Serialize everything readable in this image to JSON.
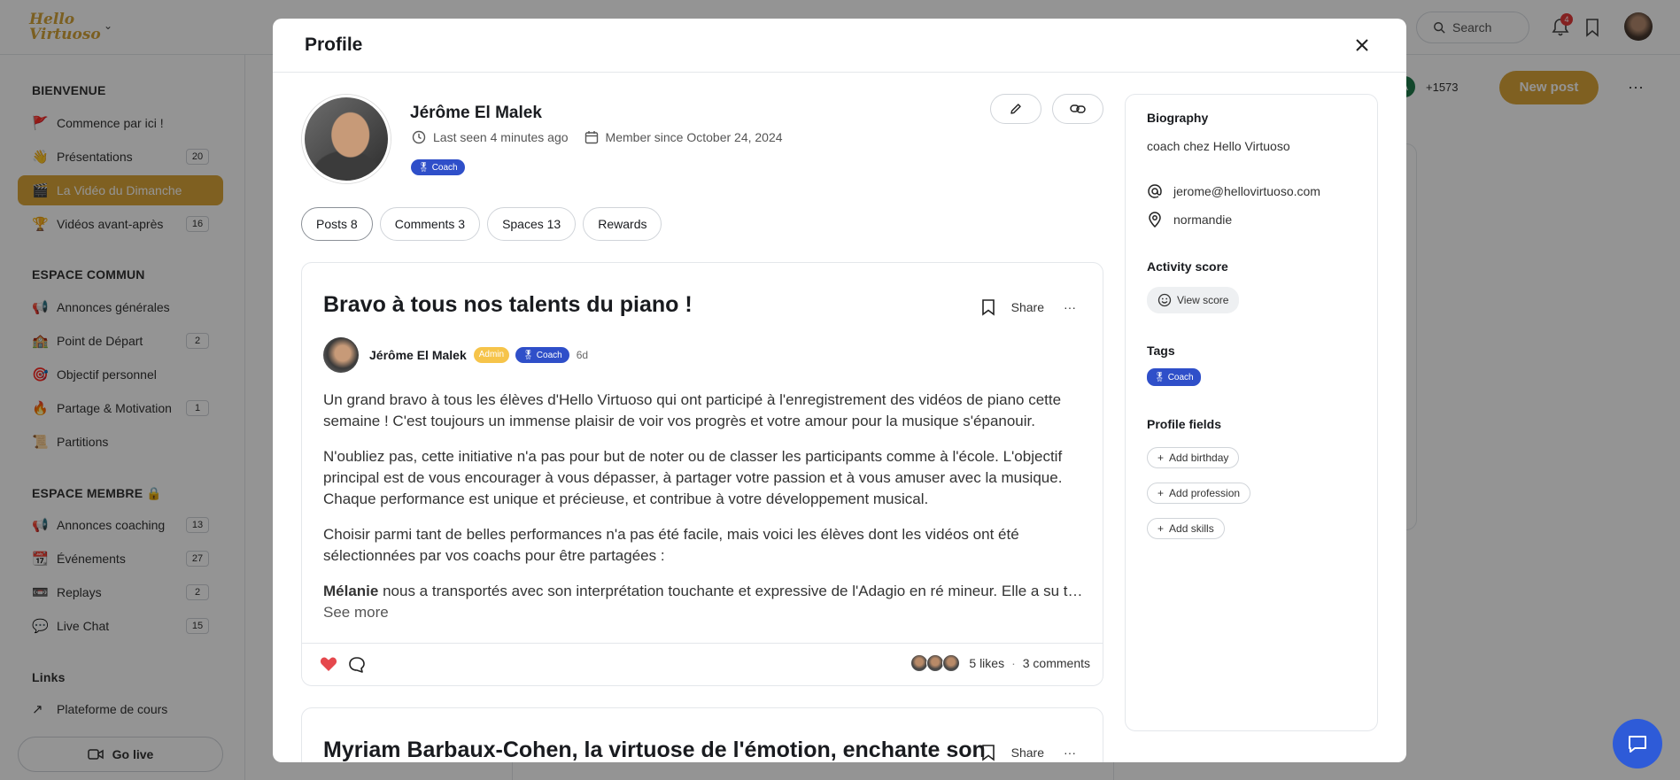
{
  "header": {
    "logo_line1": "Hello",
    "logo_line2": "Virtuoso",
    "search_label": "Search",
    "notification_count": "4"
  },
  "sidebar": {
    "sections": [
      {
        "title": "BIENVENUE",
        "items": [
          {
            "emoji": "🚩",
            "label": "Commence par ici !",
            "count": ""
          },
          {
            "emoji": "👋",
            "label": "Présentations",
            "count": "20"
          },
          {
            "emoji": "🎬",
            "label": "La Vidéo du Dimanche",
            "count": "",
            "active": true
          },
          {
            "emoji": "🏆",
            "label": "Vidéos avant-après",
            "count": "16"
          }
        ]
      },
      {
        "title": "ESPACE COMMUN",
        "items": [
          {
            "emoji": "📢",
            "label": "Annonces générales",
            "count": ""
          },
          {
            "emoji": "🏫",
            "label": "Point de Départ",
            "count": "2"
          },
          {
            "emoji": "🎯",
            "label": "Objectif personnel",
            "count": ""
          },
          {
            "emoji": "🔥",
            "label": "Partage & Motivation",
            "count": "1"
          },
          {
            "emoji": "📜",
            "label": "Partitions",
            "count": ""
          }
        ]
      },
      {
        "title": "ESPACE MEMBRE 🔒",
        "items": [
          {
            "emoji": "📢",
            "label": "Annonces coaching",
            "count": "13"
          },
          {
            "emoji": "📆",
            "label": "Événements",
            "count": "27"
          },
          {
            "emoji": "📼",
            "label": "Replays",
            "count": "2"
          },
          {
            "emoji": "💬",
            "label": "Live Chat",
            "count": "15"
          }
        ]
      },
      {
        "title": "Links",
        "items": [
          {
            "emoji": "↗",
            "label": "Plateforme de cours",
            "count": ""
          }
        ]
      }
    ],
    "go_live_label": "Go live"
  },
  "topbar": {
    "member_initial": "A",
    "member_count": "+1573",
    "new_post_label": "New post"
  },
  "modal": {
    "title": "Profile",
    "profile": {
      "name": "Jérôme El Malek",
      "last_seen": "Last seen 4 minutes ago",
      "member_since": "Member since October 24, 2024",
      "badge": "Coach"
    },
    "tabs": [
      {
        "label": "Posts 8",
        "active": true
      },
      {
        "label": "Comments 3"
      },
      {
        "label": "Spaces 13"
      },
      {
        "label": "Rewards"
      }
    ],
    "posts": [
      {
        "title": "Bravo à tous nos talents du piano !",
        "share_label": "Share",
        "author": "Jérôme El Malek",
        "admin_badge": "Admin",
        "coach_badge": "Coach",
        "age": "6d",
        "paragraphs": [
          "Un grand bravo à tous les élèves d'Hello Virtuoso qui ont participé à l'enregistrement des vidéos de piano cette semaine ! C'est toujours un immense plaisir de voir vos progrès et votre amour pour la musique s'épanouir.",
          "N'oubliez pas, cette initiative n'a pas pour but de noter ou de classer les participants comme à l'école. L'objectif principal est de vous encourager à vous dépasser, à partager votre passion et à vous amuser avec la musique. Chaque performance est unique et précieuse, et contribue à votre développement musical.",
          "Choisir parmi tant de belles performances n'a pas été facile, mais voici les élèves dont les vidéos ont été sélectionnées par vos coachs pour être partagées :"
        ],
        "truncated_bold": "Mélanie",
        "truncated_rest": " nous a transportés avec son interprétation touchante et expressive de l'Adagio en ré mineur. Elle a su transmettre toute l'émotion",
        "see_more": "See more",
        "likes": "5 likes",
        "comments": "3 comments"
      },
      {
        "title": "Myriam Barbaux-Cohen, la virtuose de l'émotion, enchante son",
        "share_label": "Share"
      }
    ],
    "about": {
      "biography_heading": "Biography",
      "biography": "coach chez Hello Virtuoso",
      "email": "jerome@hellovirtuoso.com",
      "location": "normandie",
      "activity_heading": "Activity score",
      "view_score": "View score",
      "tags_heading": "Tags",
      "tag": "Coach",
      "fields_heading": "Profile fields",
      "add_birthday": "Add birthday",
      "add_profession": "Add profession",
      "add_skills": "Add skills"
    }
  }
}
